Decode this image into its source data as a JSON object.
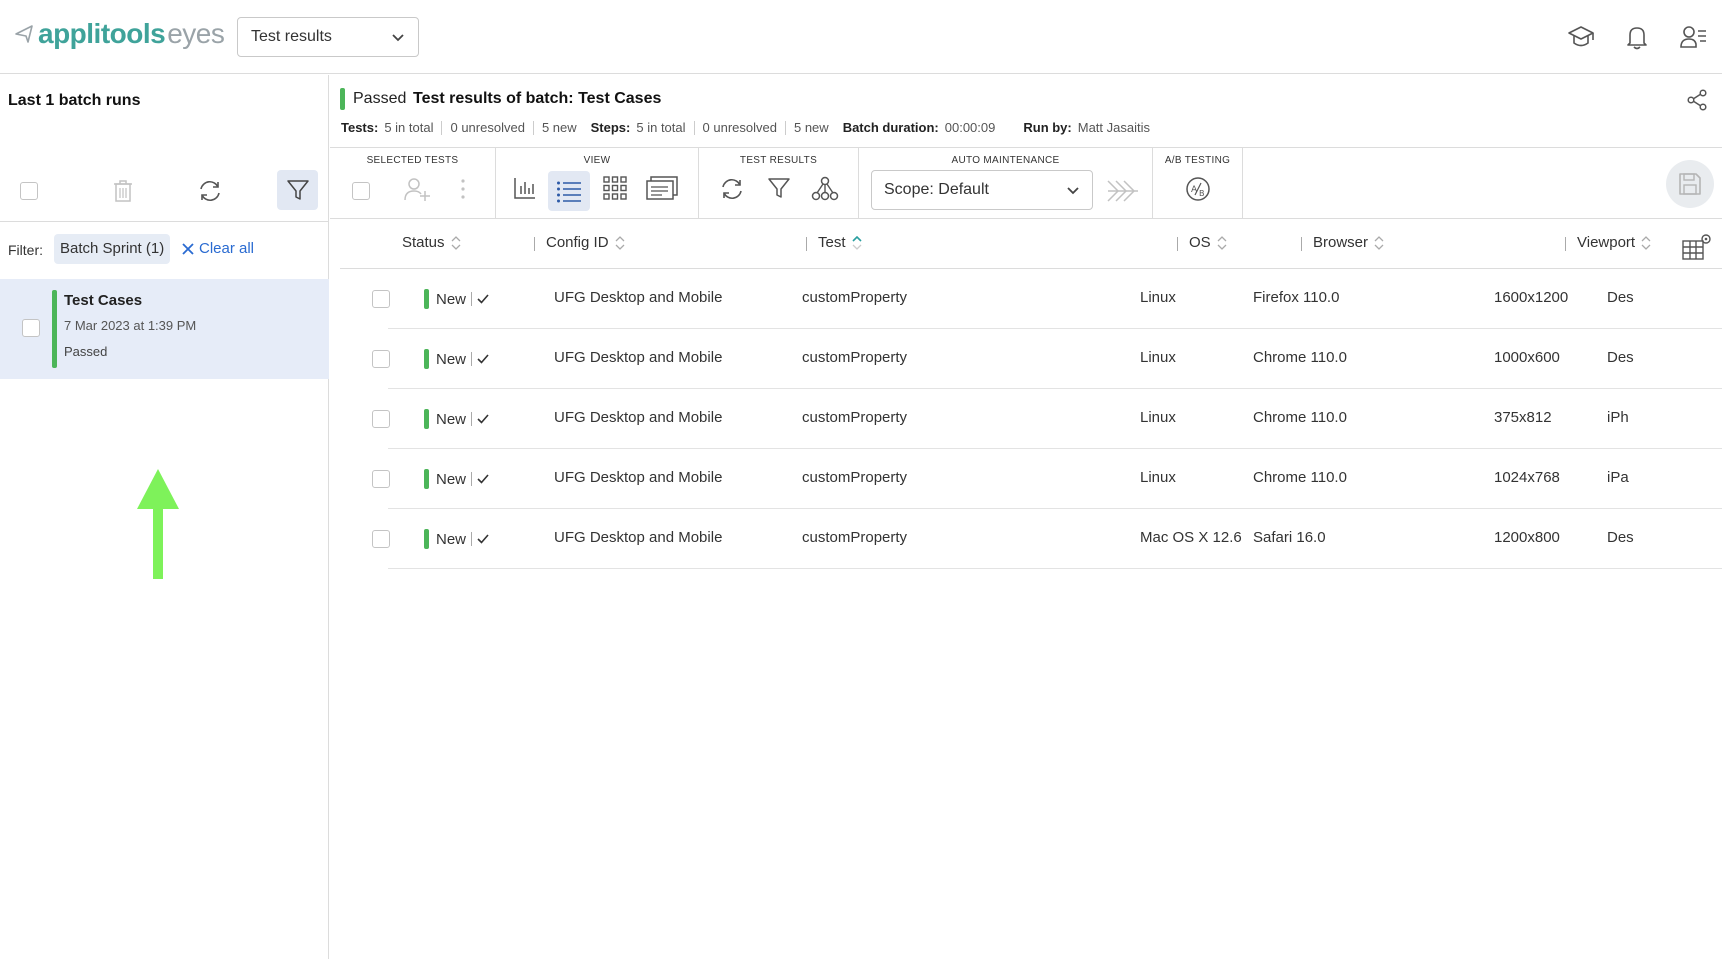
{
  "app": {
    "logo_a": "applitools",
    "logo_b": "eyes"
  },
  "header": {
    "view_select": "Test results"
  },
  "left": {
    "title": "Last 1 batch runs",
    "filter_label": "Filter:",
    "filter_chip": "Batch Sprint (1)",
    "clear_all": "Clear all",
    "batch": {
      "name": "Test Cases",
      "date": "7 Mar 2023 at 1:39 PM",
      "status": "Passed"
    }
  },
  "main": {
    "status": "Passed",
    "title": "Test results of batch:  Test Cases",
    "stats": {
      "tests_label": "Tests:",
      "tests_total": "5 in total",
      "tests_unresolved": "0 unresolved",
      "tests_new": "5 new",
      "steps_label": "Steps:",
      "steps_total": "5 in total",
      "steps_unresolved": "0 unresolved",
      "steps_new": "5 new",
      "duration_label": "Batch duration:",
      "duration": "00:00:09",
      "runby_label": "Run by:",
      "runby": "Matt Jasaitis"
    }
  },
  "toolbar": {
    "selected_tests": "SELECTED TESTS",
    "view": "VIEW",
    "test_results": "TEST RESULTS",
    "auto_maintenance": "AUTO MAINTENANCE",
    "ab_testing": "A/B TESTING",
    "scope": "Scope: Default"
  },
  "table": {
    "columns": {
      "status": "Status",
      "config": "Config ID",
      "test": "Test",
      "os": "OS",
      "browser": "Browser",
      "viewport": "Viewport"
    },
    "rows": [
      {
        "status": "New",
        "config": "UFG Desktop and Mobile",
        "test": "customProperty",
        "os": "Linux",
        "browser": "Firefox 110.0",
        "viewport": "1600x1200",
        "device": "Des"
      },
      {
        "status": "New",
        "config": "UFG Desktop and Mobile",
        "test": "customProperty",
        "os": "Linux",
        "browser": "Chrome 110.0",
        "viewport": "1000x600",
        "device": "Des"
      },
      {
        "status": "New",
        "config": "UFG Desktop and Mobile",
        "test": "customProperty",
        "os": "Linux",
        "browser": "Chrome 110.0",
        "viewport": "375x812",
        "device": "iPh"
      },
      {
        "status": "New",
        "config": "UFG Desktop and Mobile",
        "test": "customProperty",
        "os": "Linux",
        "browser": "Chrome 110.0",
        "viewport": "1024x768",
        "device": "iPa"
      },
      {
        "status": "New",
        "config": "UFG Desktop and Mobile",
        "test": "customProperty",
        "os": "Mac OS X 12.6",
        "browser": "Safari 16.0",
        "viewport": "1200x800",
        "device": "Des"
      }
    ]
  },
  "colors": {
    "accent": "#3fa39a",
    "passed": "#4cb559",
    "link": "#2a6bd1",
    "arrow": "#7ef25a"
  }
}
